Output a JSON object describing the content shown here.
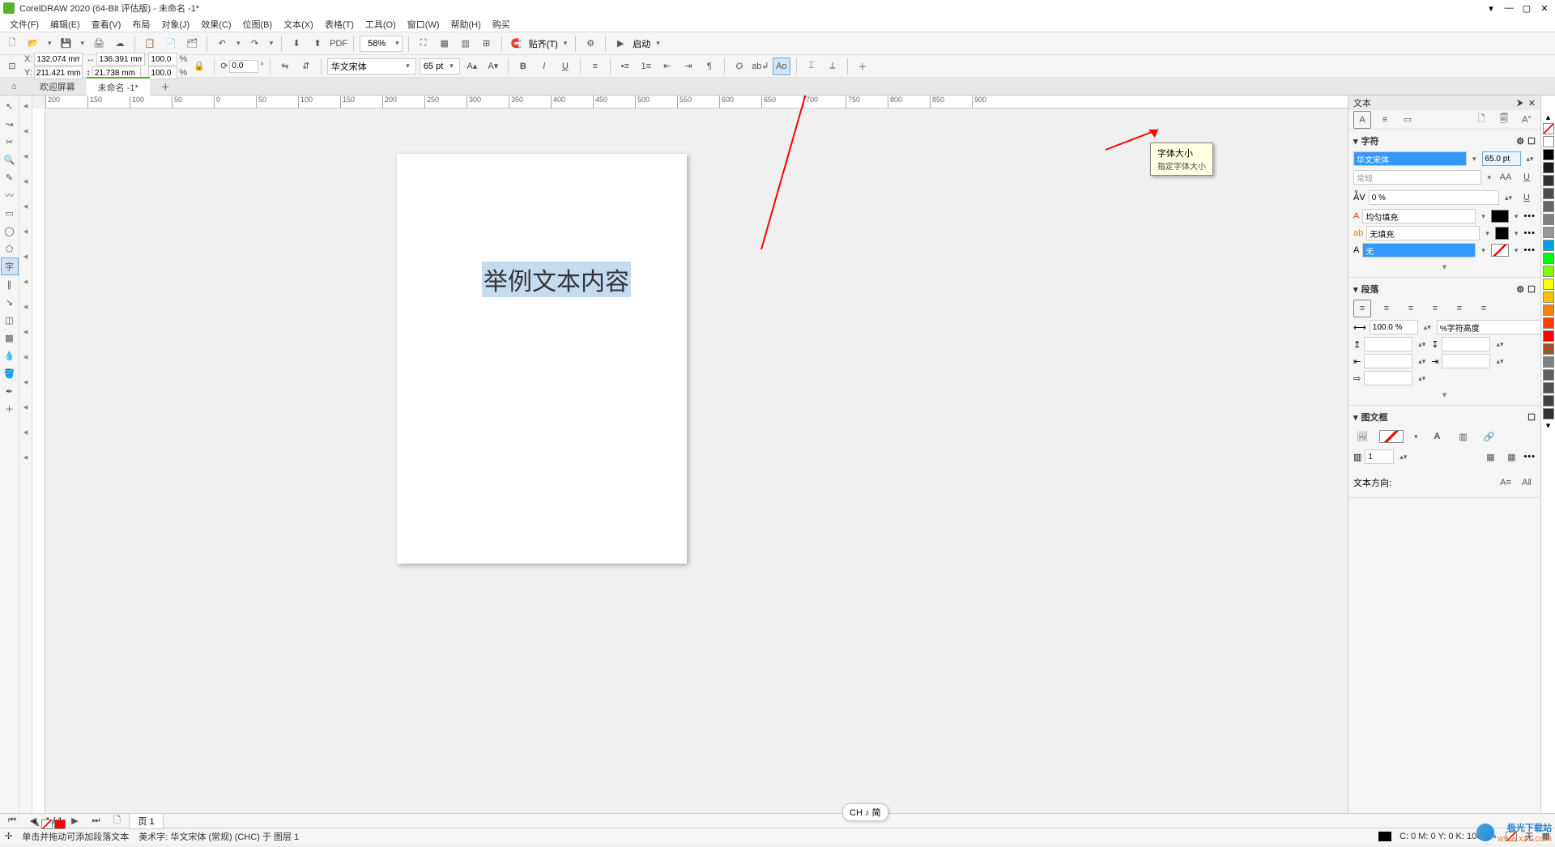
{
  "app": {
    "title": "CorelDRAW 2020 (64-Bit 评估版) - 未命名 -1*"
  },
  "menu": [
    "文件(F)",
    "编辑(E)",
    "查看(V)",
    "布局",
    "对象(J)",
    "效果(C)",
    "位图(B)",
    "文本(X)",
    "表格(T)",
    "工具(O)",
    "窗口(W)",
    "帮助(H)",
    "购买"
  ],
  "toolbar1": {
    "zoom": "58%",
    "snap": "贴齐(T)",
    "launch": "启动"
  },
  "toolbar2": {
    "x": "132.074 mm",
    "y": "211.421 mm",
    "w": "136.391 mm",
    "h": "21.738 mm",
    "sx": "100.0",
    "sy": "100.0",
    "sxu": "%",
    "syu": "%",
    "rot": "0.0",
    "font": "华文宋体",
    "size": "65 pt"
  },
  "tabs": {
    "welcome": "欢迎屏幕",
    "doc": "未命名 -1*"
  },
  "ruler_ticks": [
    "200",
    "150",
    "100",
    "50",
    "0",
    "50",
    "100",
    "150",
    "200",
    "250",
    "300",
    "350",
    "400",
    "450",
    "500",
    "550",
    "600",
    "650",
    "700",
    "750",
    "800",
    "850",
    "900"
  ],
  "canvas": {
    "sample_text": "举例文本内容"
  },
  "docker": {
    "title": "文本",
    "sect_char": "字符",
    "font": "华文宋体",
    "size": "65.0 pt",
    "style": "常规",
    "kern": "0 %",
    "fill_mode": "均匀填充",
    "nofill": "无填充",
    "outline_none": "无",
    "sect_para": "段落",
    "line_h": "100.0 %",
    "line_h_mode": "%字符高度",
    "sect_imgfrm": "图文框",
    "col_count": "1",
    "dir_label": "文本方向:"
  },
  "tooltip": {
    "line1": "字体大小",
    "line2": "指定字体大小"
  },
  "pagebar": {
    "page": "页 1"
  },
  "status": {
    "hint": "单击并拖动可添加段落文本",
    "art": "美术字: 华文宋体 (常规) (CHC) 于 图层 1",
    "ime": "CH ♪ 简",
    "color": "C: 0 M: 0 Y: 0 K: 100",
    "fill_none": "无"
  },
  "watermark": {
    "name": "极光下载站",
    "url": "www.xz7.com"
  },
  "palette": [
    "#ffffff",
    "#000000",
    "#1a1a1a",
    "#333333",
    "#4d4d4d",
    "#666666",
    "#808080",
    "#999999",
    "#00a0e9",
    "#00ff00",
    "#7fff00",
    "#ffff00",
    "#ffc000",
    "#ff8000",
    "#ff4000",
    "#ff0000",
    "#a0522d",
    "#808080",
    "#606060",
    "#505050",
    "#404040",
    "#303030"
  ]
}
